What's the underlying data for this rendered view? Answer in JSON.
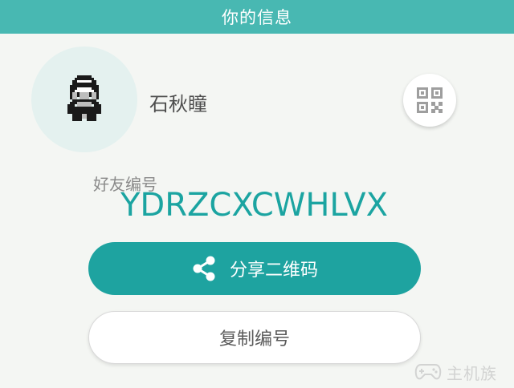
{
  "header": {
    "title": "你的信息"
  },
  "profile": {
    "name": "石秋瞳",
    "avatar_icon": "pixel-trainer-avatar-icon"
  },
  "qr": {
    "icon": "qr-code-icon"
  },
  "friend_code": {
    "label": "好友编号",
    "value": "YDRZCXCWHLVX"
  },
  "actions": {
    "share_label": "分享二维码",
    "share_icon": "share-icon",
    "copy_label": "复制编号"
  },
  "watermark": {
    "text": "主机族"
  },
  "colors": {
    "header": "#48b8b2",
    "accent": "#1ea3a0",
    "code_text": "#1ba4a1",
    "background": "#f4f6f3"
  }
}
